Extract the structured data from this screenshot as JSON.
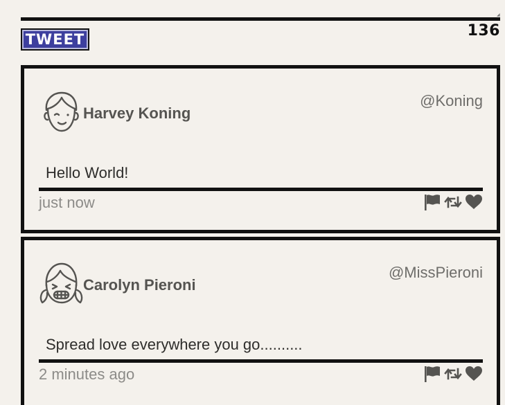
{
  "compose": {
    "textarea_value": "",
    "button_label": "TWEET",
    "char_count": "136"
  },
  "tweets": [
    {
      "name": "Harvey Koning",
      "handle": "@Koning",
      "text": "Hello World!",
      "time": "just now",
      "avatar_icon": "boy-face-icon"
    },
    {
      "name": "Carolyn Pieroni",
      "handle": "@MissPieroni",
      "text": "Spread love everywhere you go..........",
      "time": "2 minutes ago",
      "avatar_icon": "girl-face-icon"
    }
  ],
  "colors": {
    "background": "#f4f1ec",
    "button_bg": "#3d3f9e",
    "border": "#111111",
    "text": "#555451",
    "muted": "#8c8b88"
  }
}
